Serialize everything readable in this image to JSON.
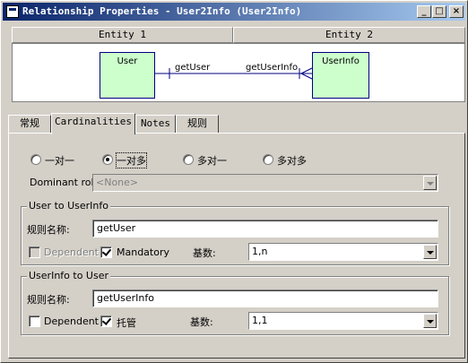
{
  "window": {
    "title": "Relationship Properties - User2Info (User2Info)",
    "minimize_label": "_",
    "maximize_label": "□",
    "close_label": "×"
  },
  "diagram": {
    "entity1_header": "Entity 1",
    "entity2_header": "Entity 2",
    "entity1_name": "User",
    "entity2_name": "UserInfo",
    "role1": "getUser",
    "role2": "getUserInfo",
    "entity_fill_color": "#ccffcc",
    "entity_border_color": "#000080"
  },
  "tabs": [
    {
      "label": "常规"
    },
    {
      "label": "Cardinalities"
    },
    {
      "label": "Notes"
    },
    {
      "label": "规则"
    }
  ],
  "cardinality_options": [
    {
      "label": "一对一",
      "checked": false
    },
    {
      "label": "一对多",
      "checked": true
    },
    {
      "label": "多对一",
      "checked": false
    },
    {
      "label": "多对多",
      "checked": false
    }
  ],
  "dominant_role": {
    "label": "Dominant role:",
    "value": "<None>"
  },
  "group1": {
    "title": "User to UserInfo",
    "rule_name_label": "规则名称:",
    "rule_name_value": "getUser",
    "dependent_label": "Dependent",
    "dependent_checked": false,
    "mandatory_label": "Mandatory",
    "mandatory_checked": true,
    "cardinality_label": "基数:",
    "cardinality_value": "1,n"
  },
  "group2": {
    "title": "UserInfo to User",
    "rule_name_label": "规则名称:",
    "rule_name_value": "getUserInfo",
    "dependent_label": "Dependent",
    "dependent_checked": false,
    "mandatory_label": "托管",
    "mandatory_checked": true,
    "cardinality_label": "基数:",
    "cardinality_value": "1,1"
  }
}
